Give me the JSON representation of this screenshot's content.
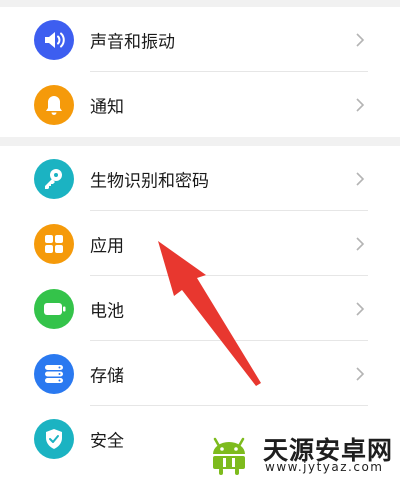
{
  "settings": {
    "group1": [
      {
        "label": "声音和振动",
        "icon": "speaker-icon",
        "color": "#3d5ef0"
      },
      {
        "label": "通知",
        "icon": "bell-icon",
        "color": "#f59a0a"
      }
    ],
    "group2": [
      {
        "label": "生物识别和密码",
        "icon": "key-icon",
        "color": "#1bb3c2"
      },
      {
        "label": "应用",
        "icon": "apps-grid-icon",
        "color": "#f59a0a"
      },
      {
        "label": "电池",
        "icon": "battery-icon",
        "color": "#34c34a"
      },
      {
        "label": "存储",
        "icon": "storage-icon",
        "color": "#2a79f0"
      },
      {
        "label": "安全",
        "icon": "shield-check-icon",
        "color": "#1bb3c2"
      }
    ]
  },
  "annotation": {
    "arrow_color": "#e8372f"
  },
  "watermark": {
    "title": "天源安卓网",
    "url": "www.jytyaz.com"
  }
}
